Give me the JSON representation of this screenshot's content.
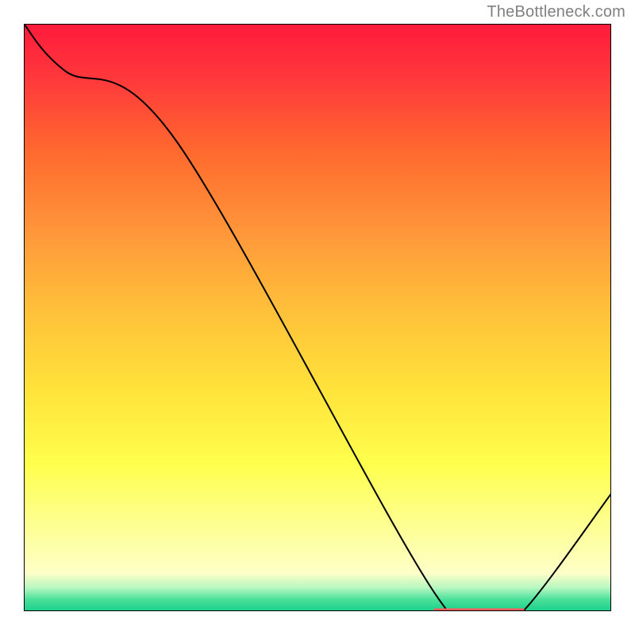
{
  "watermark": "TheBottleneck.com",
  "chart_data": {
    "type": "line",
    "title": "",
    "xlabel": "",
    "ylabel": "",
    "xlim": [
      0,
      100
    ],
    "ylim": [
      0,
      100
    ],
    "background_gradient": {
      "type": "rainbow-vertical",
      "stops": [
        {
          "pos": 0.0,
          "color": "#ff1a3c"
        },
        {
          "pos": 0.1,
          "color": "#ff3b3b"
        },
        {
          "pos": 0.22,
          "color": "#ff6a2e"
        },
        {
          "pos": 0.35,
          "color": "#ff953a"
        },
        {
          "pos": 0.48,
          "color": "#ffbe3a"
        },
        {
          "pos": 0.62,
          "color": "#ffe23a"
        },
        {
          "pos": 0.75,
          "color": "#ffff4d"
        },
        {
          "pos": 0.86,
          "color": "#fdff96"
        },
        {
          "pos": 0.935,
          "color": "#feffc7"
        },
        {
          "pos": 0.96,
          "color": "#b7f8c0"
        },
        {
          "pos": 0.98,
          "color": "#4be09b"
        },
        {
          "pos": 1.0,
          "color": "#18d18a"
        }
      ]
    },
    "x": [
      0,
      7,
      26,
      70,
      80,
      85,
      100
    ],
    "values": [
      100,
      92,
      80,
      3,
      0,
      0,
      20
    ],
    "baseline_marker": {
      "x_range": [
        70,
        85
      ],
      "y": 0,
      "color": "#ff5b5b",
      "thickness": 3
    }
  }
}
